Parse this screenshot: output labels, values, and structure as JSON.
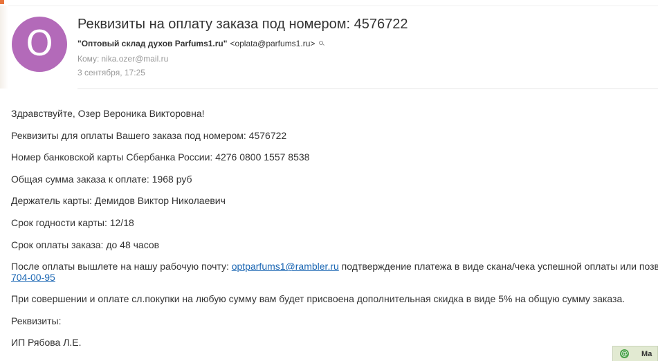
{
  "header": {
    "avatar_letter": "O",
    "subject": "Реквизиты на оплату заказа под номером: 4576722",
    "sender_name": "\"Оптовый склад духов Parfums1.ru\"",
    "sender_email": "<oplata@parfums1.ru>",
    "recipient_label": "Кому:",
    "recipient": "nika.ozer@mail.ru",
    "date": "3 сентября, 17:25"
  },
  "body": {
    "greeting": "Здравствуйте, Озер Вероника Викторовна!",
    "order_line": "Реквизиты для оплаты Вашего заказа под номером: 4576722",
    "card_line": "Номер банковской карты Сбербанка России: 4276 0800 1557 8538",
    "sum_line": "Общая сумма заказа к оплате: 1968 руб",
    "holder_line": "Держатель карты: Демидов Виктор Николаевич",
    "expiry_line": "Срок годности карты: 12/18",
    "deadline_line": "Срок оплаты заказа: до 48 часов",
    "after_pay_prefix": "После оплаты вышлете на нашу рабочую почту: ",
    "after_pay_email": "optparfums1@rambler.ru",
    "after_pay_suffix": " подтверждение платежа в виде скана/чека успешной оплаты или позвоните",
    "phone": "704-00-95",
    "discount_line": "При совершении и оплате сл.покупки на любую сумму вам будет присвоена дополнительная скидка в виде 5% на общую сумму заказа.",
    "requisites_label": "Реквизиты:",
    "ip_line": "ИП Рябова Л.Е."
  },
  "chat_tab": {
    "icon": "@",
    "label": "Ма"
  }
}
